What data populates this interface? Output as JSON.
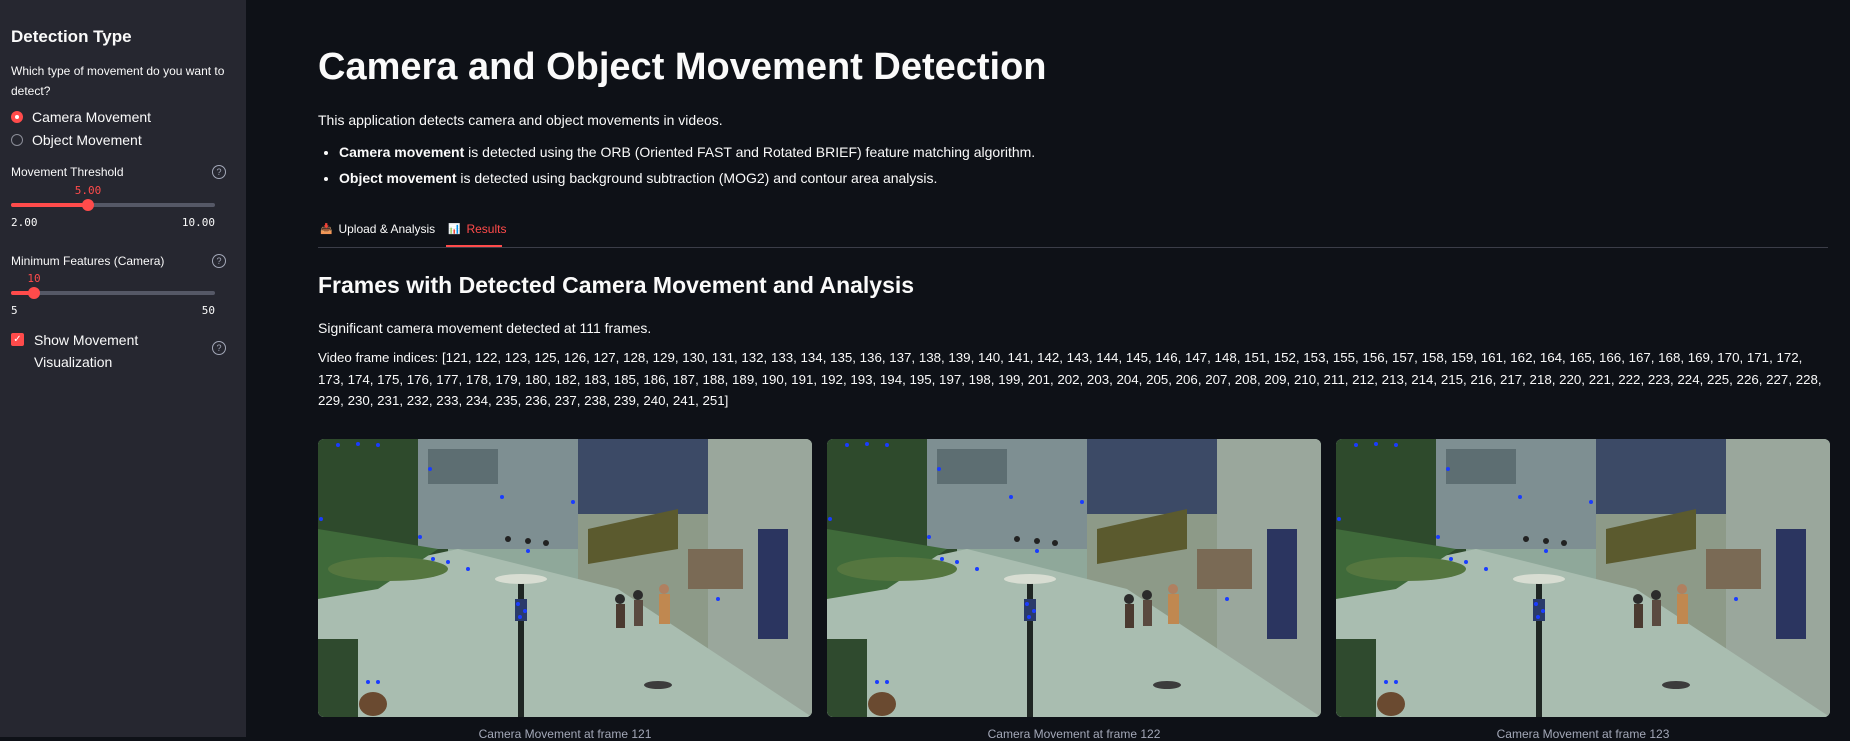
{
  "sidebar": {
    "title": "Detection Type",
    "question": "Which type of movement do you want to detect?",
    "radios": [
      {
        "label": "Camera Movement",
        "selected": true
      },
      {
        "label": "Object Movement",
        "selected": false
      }
    ],
    "threshold": {
      "label": "Movement Threshold",
      "value": "5.00",
      "min": "2.00",
      "max": "10.00",
      "fraction": 0.375
    },
    "min_features": {
      "label": "Minimum Features (Camera)",
      "value": "10",
      "min": "5",
      "max": "50",
      "fraction": 0.111
    },
    "show_viz": {
      "label": "Show Movement Visualization",
      "checked": true
    },
    "help_glyph": "?"
  },
  "main": {
    "title": "Camera and Object Movement Detection",
    "intro": "This application detects camera and object movements in videos.",
    "bullets": [
      {
        "bold": "Camera movement",
        "rest": " is detected using the ORB (Oriented FAST and Rotated BRIEF) feature matching algorithm."
      },
      {
        "bold": "Object movement",
        "rest": " is detected using background subtraction (MOG2) and contour area analysis."
      }
    ],
    "tabs": [
      {
        "icon": "upload-icon",
        "label": "Upload & Analysis"
      },
      {
        "icon": "chart-icon",
        "label": "Results"
      }
    ],
    "section_title": "Frames with Detected Camera Movement and Analysis",
    "summary": "Significant camera movement detected at 111 frames.",
    "indices_label": "Video frame indices: ",
    "indices": "[121, 122, 123, 125, 126, 127, 128, 129, 130, 131, 132, 133, 134, 135, 136, 137, 138, 139, 140, 141, 142, 143, 144, 145, 146, 147, 148, 151, 152, 153, 155, 156, 157, 158, 159, 161, 162, 164, 165, 166, 167, 168, 169, 170, 171, 172, 173, 174, 175, 176, 177, 178, 179, 180, 182, 183, 185, 186, 187, 188, 189, 190, 191, 192, 193, 194, 195, 197, 198, 199, 201, 202, 203, 204, 205, 206, 207, 208, 209, 210, 211, 212, 213, 214, 215, 216, 217, 218, 220, 221, 222, 223, 224, 225, 226, 227, 228, 229, 230, 231, 232, 233, 234, 235, 236, 237, 238, 239, 240, 241, 251]",
    "frames": [
      {
        "caption": "Camera Movement at frame 121"
      },
      {
        "caption": "Camera Movement at frame 122"
      },
      {
        "caption": "Camera Movement at frame 123"
      }
    ]
  },
  "colors": {
    "accent": "#ff4b4b",
    "background": "#0e1117",
    "sidebar": "#262730"
  }
}
